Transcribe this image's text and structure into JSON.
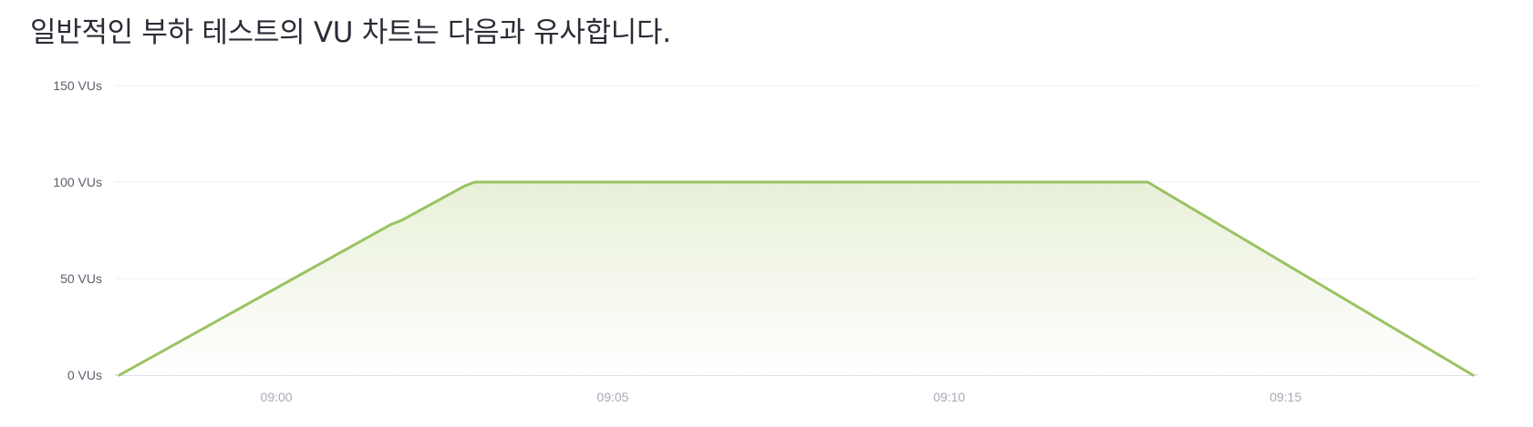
{
  "intro_text": "일반적인 부하 테스트의 VU 차트는 다음과 유사합니다.",
  "colors": {
    "line": "#9bc261",
    "fill_top": "#e8f0d8",
    "fill_bottom": "#ffffff",
    "grid": "#eceff3",
    "baseline": "#c9ccdc"
  },
  "chart_data": {
    "type": "area",
    "title": "",
    "xlabel": "",
    "ylabel": "",
    "y_ticks": [
      {
        "value": 0,
        "label": "0 VUs"
      },
      {
        "value": 50,
        "label": "50 VUs"
      },
      {
        "value": 100,
        "label": "100 VUs"
      },
      {
        "value": 150,
        "label": "150 VUs"
      }
    ],
    "x_ticks": [
      "09:00",
      "09:05",
      "09:10",
      "09:15"
    ],
    "ylim": [
      0,
      150
    ],
    "xlim": [
      "08:57:36",
      "09:17:51"
    ],
    "grid": true,
    "legend": "none",
    "series": [
      {
        "values": [
          {
            "t": "08:57:40",
            "vus": 0
          },
          {
            "t": "09:01:42",
            "vus": 78
          },
          {
            "t": "09:01:51",
            "vus": 80
          },
          {
            "t": "09:02:48",
            "vus": 98
          },
          {
            "t": "09:02:57",
            "vus": 100
          },
          {
            "t": "09:12:57",
            "vus": 100
          },
          {
            "t": "09:17:47",
            "vus": 0
          }
        ]
      }
    ]
  }
}
